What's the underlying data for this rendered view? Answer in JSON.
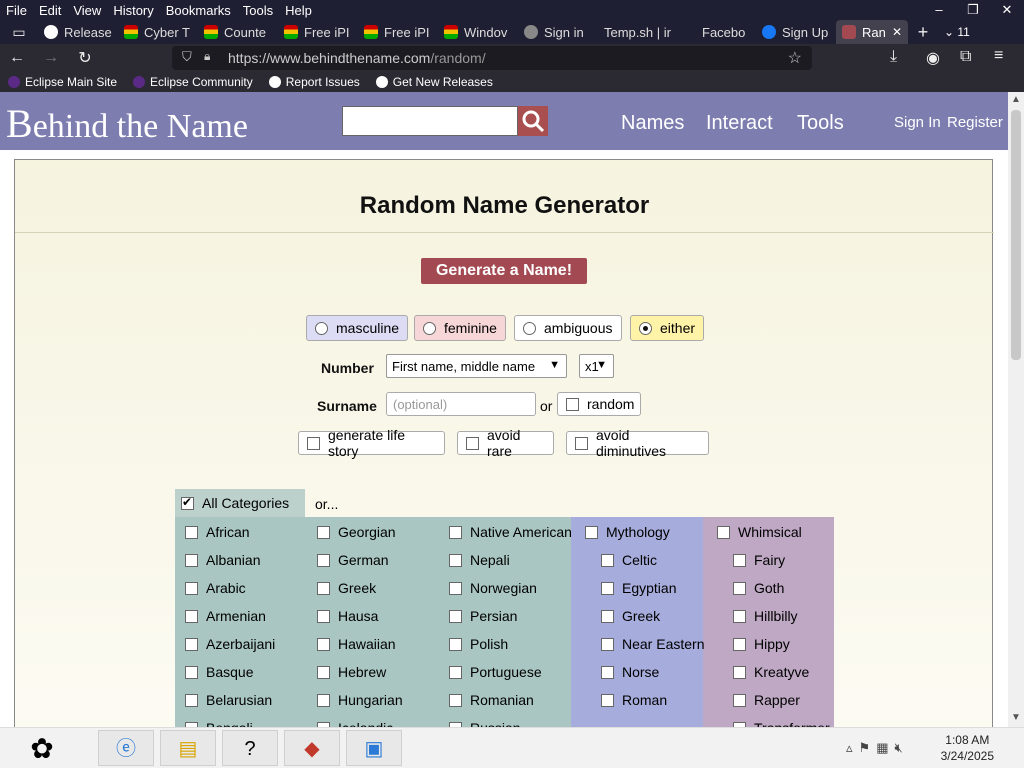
{
  "menu": [
    "File",
    "Edit",
    "View",
    "History",
    "Bookmarks",
    "Tools",
    "Help"
  ],
  "window_controls": [
    "–",
    "❐",
    "✕"
  ],
  "tabs": [
    {
      "label": "Release",
      "color": "#ffffff"
    },
    {
      "label": "Cyber T",
      "color": "#f2c200"
    },
    {
      "label": "Counte",
      "color": "#f2c200"
    },
    {
      "label": "Free iPI",
      "color": "#f2c200"
    },
    {
      "label": "Free iPI",
      "color": "#f2c200"
    },
    {
      "label": "Windov",
      "color": "#f2c200"
    },
    {
      "label": "Sign in",
      "color": "#888888"
    },
    {
      "label": "Temp.sh | ir",
      "color": "#1f1f33"
    },
    {
      "label": "Facebo",
      "color": "#1f1f33"
    },
    {
      "label": "Sign Up",
      "color": "#1877f2"
    },
    {
      "label": "Ran",
      "color": "#a34952"
    }
  ],
  "tab_count": "11",
  "url": {
    "host": "https://www.behindthename.com",
    "path": "/random/"
  },
  "bookmarks": [
    "Eclipse Main Site",
    "Eclipse Community",
    "Report Issues",
    "Get New Releases"
  ],
  "site": {
    "logo_first": "B",
    "logo_rest": "ehind the Name",
    "nav": [
      "Names",
      "Interact",
      "Tools"
    ],
    "links": [
      "Sign In",
      "Register"
    ]
  },
  "form": {
    "title": "Random Name Generator",
    "generate": "Generate a Name!",
    "genders": [
      {
        "label": "masculine",
        "bg": "#dcdcf5",
        "checked": false
      },
      {
        "label": "feminine",
        "bg": "#f6d6d6",
        "checked": false
      },
      {
        "label": "ambiguous",
        "bg": "#ffffff",
        "checked": false
      },
      {
        "label": "either",
        "bg": "#fff3a8",
        "checked": true
      }
    ],
    "number_label": "Number",
    "number_value": "First name, middle name",
    "multiplier": "x1",
    "surname_label": "Surname",
    "surname_placeholder": "(optional)",
    "or": "or",
    "random": "random",
    "options": [
      "generate life story",
      "avoid rare",
      "avoid diminutives"
    ],
    "all_categories": "All Categories",
    "or2": "or..."
  },
  "categories": {
    "col1": [
      "African",
      "Albanian",
      "Arabic",
      "Armenian",
      "Azerbaijani",
      "Basque",
      "Belarusian",
      "Bengali"
    ],
    "col2": [
      "Georgian",
      "German",
      "Greek",
      "Hausa",
      "Hawaiian",
      "Hebrew",
      "Hungarian",
      "Icelandic"
    ],
    "col3": [
      "Native American",
      "Nepali",
      "Norwegian",
      "Persian",
      "Polish",
      "Portuguese",
      "Romanian",
      "Russian"
    ],
    "col4": [
      "Mythology",
      "Celtic",
      "Egyptian",
      "Greek",
      "Near Eastern",
      "Norse",
      "Roman"
    ],
    "col5": [
      "Whimsical",
      "Fairy",
      "Goth",
      "Hillbilly",
      "Hippy",
      "Kreatyve",
      "Rapper",
      "Transformer"
    ]
  },
  "clock": {
    "time": "1:08 AM",
    "date": "3/24/2025"
  }
}
